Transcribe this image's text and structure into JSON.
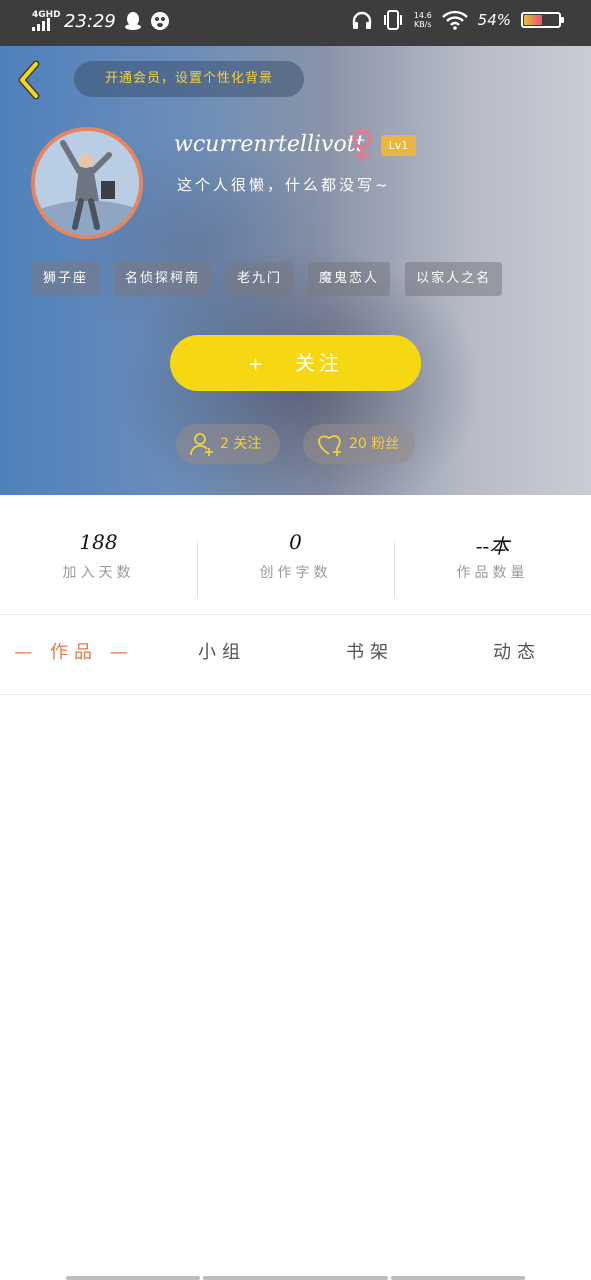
{
  "status_bar": {
    "network": "4GHD",
    "time": "23:29",
    "speed": "14.6",
    "speed_unit": "KB/s",
    "battery": "54%",
    "icons": [
      "qq-icon",
      "baidu-icon",
      "headphones-icon",
      "vibrate-icon",
      "wifi-icon",
      "battery-icon"
    ]
  },
  "header": {
    "vip_banner": "开通会员，设置个性化背景",
    "username": "wcurrenrtellivott",
    "level": "Lv1",
    "signature": "这个人很懒，什么都没写~",
    "tags": [
      "狮子座",
      "名侦探柯南",
      "老九门",
      "魔鬼恋人",
      "以家人之名"
    ],
    "follow_button": "关注",
    "follow_icon": "+",
    "following": "2 关注",
    "fans": "20 粉丝",
    "accent_color": "#f5d712",
    "avatar_border_color": "#e8845e",
    "gender_color": "#e07a8c"
  },
  "stats": [
    {
      "value": "188",
      "label": "加入天数"
    },
    {
      "value": "0",
      "label": "创作字数"
    },
    {
      "value": "--本",
      "label": "作品数量"
    }
  ],
  "tabs": [
    {
      "label": "— 作品 —",
      "active": true
    },
    {
      "label": "小组",
      "active": false
    },
    {
      "label": "书架",
      "active": false
    },
    {
      "label": "动态",
      "active": false
    }
  ],
  "colors": {
    "active_tab": "#e27b47"
  }
}
